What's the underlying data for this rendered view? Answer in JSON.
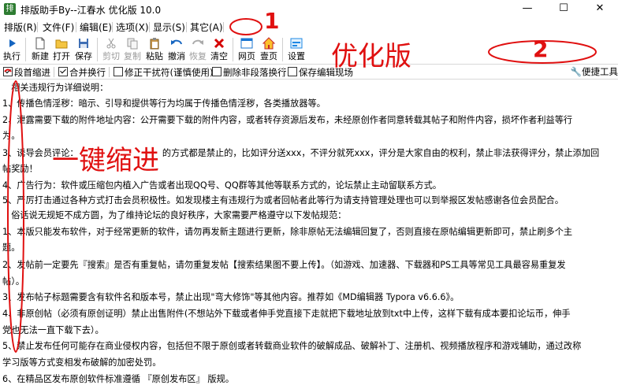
{
  "window": {
    "title": "排版助手By--江春水 优化版 10.0",
    "minimize": "—",
    "maximize": "☐",
    "close": "✕"
  },
  "menu": [
    "排版(R)",
    "文件(F)",
    "编辑(E)",
    "选项(X)",
    "显示(S)",
    "其它(A)"
  ],
  "toolbar": {
    "run": "执行",
    "new": "新建",
    "open": "打开",
    "save": "保存",
    "cut": "剪切",
    "copy": "复制",
    "paste": "粘贴",
    "undo": "撤消",
    "redo": "恢复",
    "clear": "清空",
    "web": "网页",
    "home": "壹页",
    "settings": "设置"
  },
  "options": {
    "para_indent": "段首缩进",
    "merge_lines": "合并换行",
    "fix_disturb": "修正干扰符(谨慎使用)",
    "delete_non_para": "删除非段落换行",
    "keep_edit": "保存编辑现场",
    "tools": "便捷工具"
  },
  "editor": {
    "lines": [
      "　相关违规行为详细说明：",
      "1、传播色情淫秽：暗示、引导和提供等行为均属于传播色情淫秽，各类播放器等。",
      "2、泄露需要下载的附件地址内容：公开需要下载的附件内容，或者转存资源后发布，未经原创作者同意转载其帖子和附件内容，损坏作者利益等行",
      "为。",
      "3、诱导会员评论：　　　　　　　　　　的方式都是禁止的，比如评分送xxx，不评分就死xxx，评分是大家自由的权利，禁止非法获得评分，禁止添加回",
      "帖奖励！",
      "4、广告行为：软件或压缩包内植入广告或者出现QQ号、QQ群等其他等联系方式的，论坛禁止主动留联系方式。",
      "5、严厉打击通过各种方式打击会员积极性。如发现楼主有违规行为或者回帖者此等行为请支持管理处理也可以到举报区发帖感谢各位会员配合。",
      "　俗话说无规矩不成方圆，为了维持论坛的良好秩序，大家需要严格遵守以下发帖规范：",
      "1、本版只能发布软件，对于经常更新的软件，请勿再发新主题进行更新，除非原帖无法编辑回复了，否则直接在原帖编辑更新即可，禁止刷多个主",
      "题。",
      "2、发帖前一定要先『搜索』是否有重复帖，请勿重复发帖【搜索结果图不要上传】。（如游戏、加速器、下载器和PS工具等常见工具最容易重复发",
      "帖）。",
      "3、发布帖子标题需要含有软件名和版本号，禁止出现\"弯大修饰\"等其他内容。推荐如《MD编辑器 Typora v6.6.6》。",
      "4、非原创帖（必须有原创证明）禁止出售附件(不想站外下载或者伸手党直接下走就把下载地址放到txt中上传，这样下载有成本要扣论坛币，伸手",
      "党也无法一直下载下去）。",
      "5、禁止发布任何可能存在商业侵权内容，包括但不限于原创或者转载商业软件的破解成品、破解补丁、注册机、视频播放程序和游戏辅助，通过改称",
      "学习版等方式变相发布破解的加密处罚。",
      "6、在精品区发布原创软件标准遵循 『原创发布区』 版规。"
    ]
  },
  "annotations": {
    "marker_1": "1",
    "marker_2": "2",
    "optimized": "优化版",
    "one_key_indent": "一键缩进"
  },
  "colors": {
    "annotation_red": "#e01010",
    "disabled_gray": "#9a9a9a"
  }
}
